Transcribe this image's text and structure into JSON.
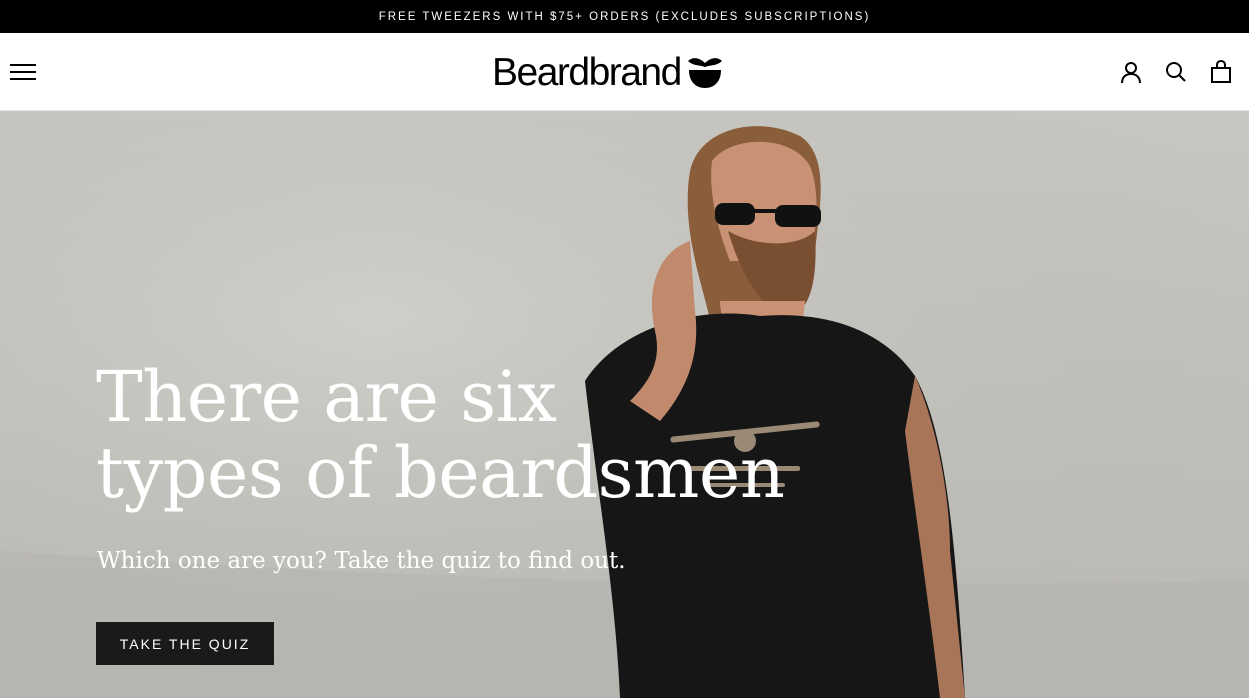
{
  "announcement": {
    "text": "FREE TWEEZERS WITH $75+ ORDERS (EXCLUDES SUBSCRIPTIONS)"
  },
  "header": {
    "logo_text": "Beardbrand",
    "icons": [
      "menu-icon",
      "account-icon",
      "search-icon",
      "cart-icon"
    ]
  },
  "hero": {
    "headline_line1": "There are six",
    "headline_line2": "types of beardsmen",
    "subheading": "Which one are you? Take the quiz to find out.",
    "cta_label": "TAKE THE QUIZ",
    "image_alt": "Bearded man wearing sunglasses and a black Beardbrand t-shirt"
  },
  "colors": {
    "announcement_bg": "#000000",
    "cta_bg": "#1a1a1a",
    "hero_bg": "#c4c2bd",
    "text_light": "#ffffff"
  }
}
